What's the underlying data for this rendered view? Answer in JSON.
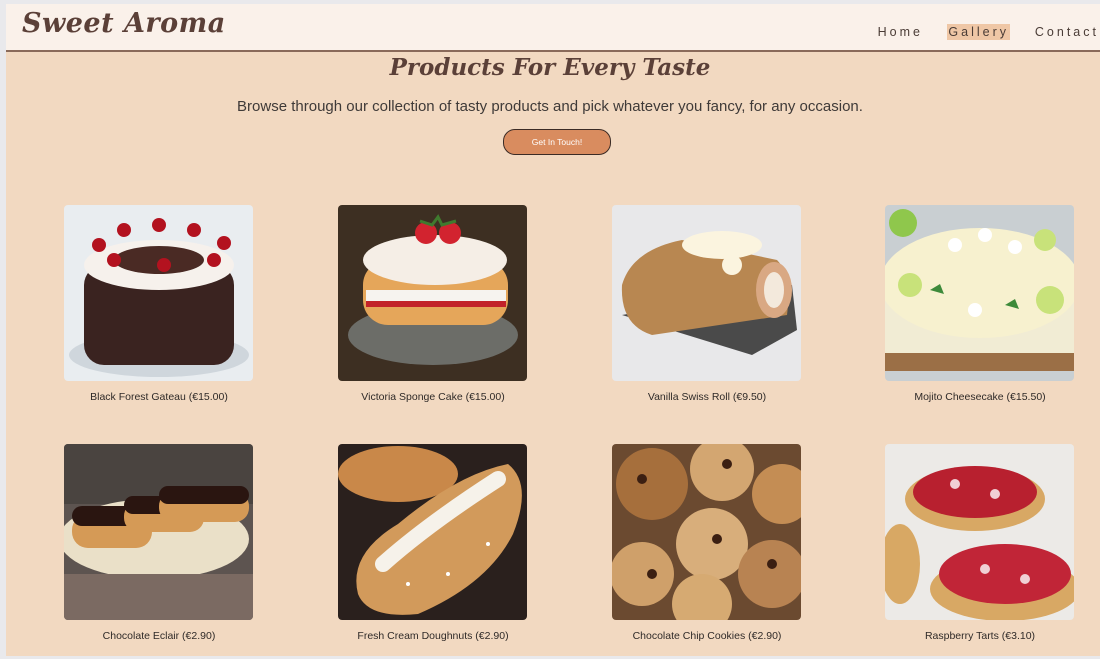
{
  "brand": "Sweet Aroma",
  "nav": {
    "home": "Home",
    "gallery": "Gallery",
    "contact": "Contact"
  },
  "hero": {
    "title": "Products For Every Taste",
    "subtitle": "Browse through our collection of tasty products and pick whatever you fancy, for any occasion.",
    "cta": "Get In Touch!"
  },
  "products": [
    {
      "name": "Black Forest Gateau (€15.00)"
    },
    {
      "name": "Victoria Sponge Cake (€15.00)"
    },
    {
      "name": "Vanilla Swiss Roll (€9.50)"
    },
    {
      "name": "Mojito Cheesecake (€15.50)"
    },
    {
      "name": "Chocolate Eclair (€2.90)"
    },
    {
      "name": "Fresh Cream Doughnuts (€2.90)"
    },
    {
      "name": "Chocolate Chip Cookies (€2.90)"
    },
    {
      "name": "Raspberry Tarts (€3.10)"
    }
  ],
  "colors": {
    "accent": "#d98c5f",
    "brand": "#5b4038",
    "page_bg": "#f2d9c1"
  }
}
